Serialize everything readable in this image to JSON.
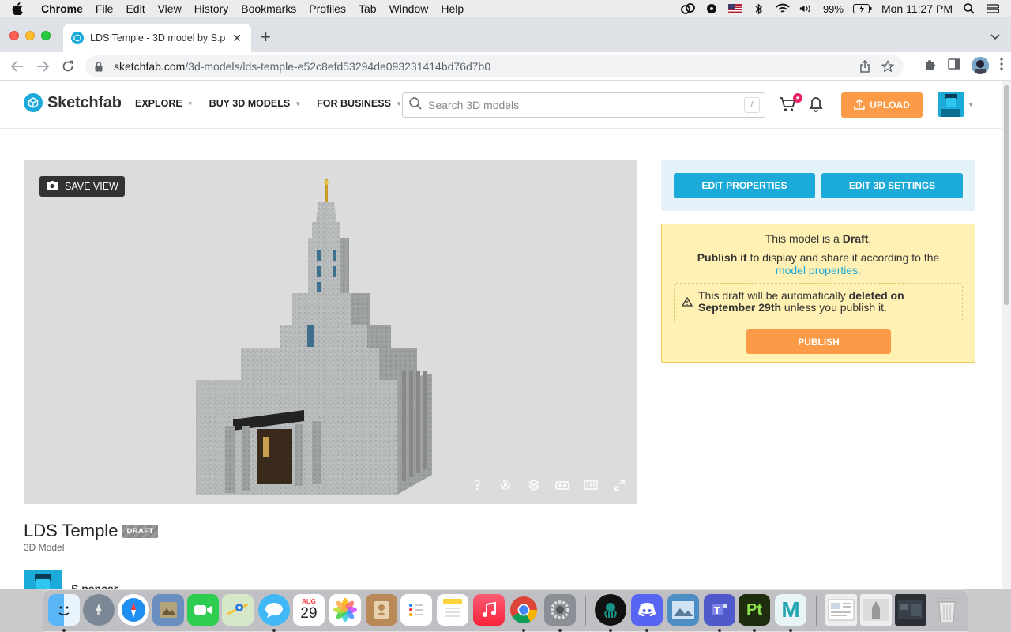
{
  "menubar": {
    "app": "Chrome",
    "items": [
      "File",
      "Edit",
      "View",
      "History",
      "Bookmarks",
      "Profiles",
      "Tab",
      "Window",
      "Help"
    ],
    "battery": "99%",
    "clock": "Mon 11:27 PM"
  },
  "browser": {
    "tab_title": "LDS Temple - 3D model by S.p",
    "url_host": "sketchfab.com",
    "url_path": "/3d-models/lds-temple-e52c8efd53294de093231414bd76d7b0"
  },
  "header": {
    "logo": "Sketchfab",
    "nav": [
      "EXPLORE",
      "BUY 3D MODELS",
      "FOR BUSINESS"
    ],
    "search_placeholder": "Search 3D models",
    "search_shortcut": "/",
    "upload_label": "UPLOAD"
  },
  "viewer": {
    "save_view_label": "SAVE VIEW",
    "controls": [
      "help-icon",
      "settings-icon",
      "layers-icon",
      "vr-icon",
      "dimensions-icon",
      "fullscreen-icon"
    ]
  },
  "edit_panel": {
    "edit_properties": "EDIT PROPERTIES",
    "edit_3d_settings": "EDIT 3D SETTINGS"
  },
  "draft_panel": {
    "line1_prefix": "This model is a ",
    "line1_strong": "Draft",
    "line1_suffix": ".",
    "line2_strong": "Publish it",
    "line2_text": " to display and share it according to the",
    "line2_link": "model properties.",
    "warning_prefix": "This draft will be automatically ",
    "warning_strong1": "deleted on",
    "warning_strong2": "September 29th",
    "warning_suffix": " unless you publish it.",
    "publish_label": "PUBLISH"
  },
  "model": {
    "title": "LDS Temple",
    "badge": "DRAFT",
    "subtitle": "3D Model",
    "author": "S.pencer"
  },
  "dock": {
    "calendar_month": "AUG",
    "calendar_day": "29",
    "pt_label": "Pt",
    "maya_label": "M"
  },
  "colors": {
    "accent": "#1caad9",
    "upload": "#fb9a47",
    "draft_bg": "#fff0b3"
  }
}
